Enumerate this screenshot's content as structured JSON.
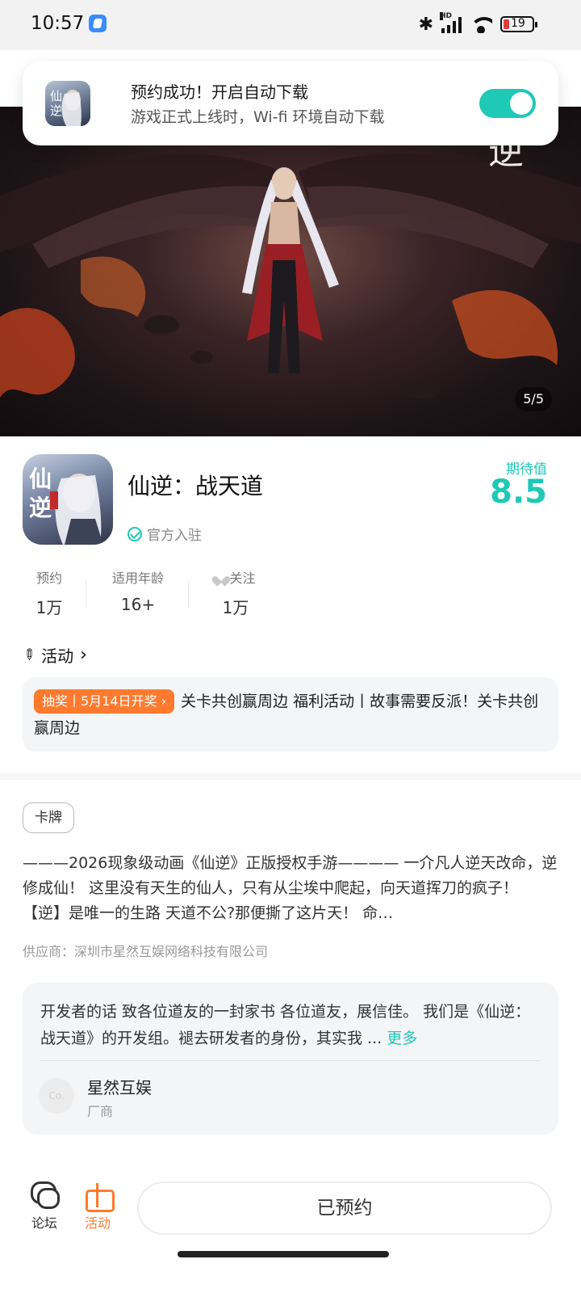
{
  "status_bar": {
    "time": "10:57",
    "battery": "19",
    "network_badge": "HD"
  },
  "toast": {
    "title": "预约成功！开启自动下载",
    "subtitle": "游戏正式上线时，Wi-fi 环境自动下载",
    "auto_download_enabled": true
  },
  "hero": {
    "counter": "5/5"
  },
  "game": {
    "title": "仙逆：战天道",
    "official_label": "官方入驻",
    "expect_label": "期待值",
    "expect_value": "8.5"
  },
  "stats": [
    {
      "label": "预约",
      "value": "1万"
    },
    {
      "label": "适用年龄",
      "value": "16+"
    },
    {
      "label": "关注",
      "value": "1万"
    }
  ],
  "activity": {
    "header": "活动",
    "tag": "抽奖丨5月14日开奖 ›",
    "text": "关卡共创赢周边 福利活动丨故事需要反派！关卡共创赢周边"
  },
  "genre_tag": "卡牌",
  "description": "———2026现象级动画《仙逆》正版授权手游———— 一介凡人逆天改命，逆修成仙！ 这里没有天生的仙人，只有从尘埃中爬起，向天道挥刀的疯子！ 【逆】是唯一的生路 天道不公?那便撕了这片天！ 命…",
  "supplier": "供应商：深圳市星然互娱网络科技有限公司",
  "developer": {
    "note": "开发者的话 致各位道友的一封家书 各位道友，展信佳。 我们是《仙逆：战天道》的开发组。褪去研发者的身份，其实我 ...",
    "more": "更多",
    "avatar_text": "Co.",
    "name": "星然互娱",
    "role": "厂商"
  },
  "bottom_nav": {
    "forum": "论坛",
    "activity": "活动",
    "reserved_button": "已预约"
  },
  "colors": {
    "accent": "#1ec9b6",
    "orange": "#ff7a2e"
  }
}
